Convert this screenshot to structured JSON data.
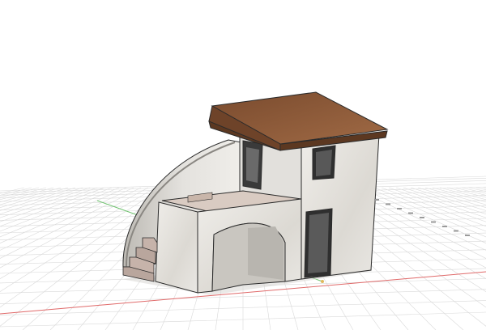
{
  "viewport": {
    "background": "#ffffff",
    "grid": true,
    "view": "perspective",
    "colors": {
      "grid_line": "#d9d9d9",
      "axis_x": "#e06a6a",
      "axis_y": "#6cc26c",
      "roof": "#8b5a3c",
      "roof_dark": "#6e4329",
      "wall": "#e8e6e2",
      "wall_shade": "#cfccc6",
      "opening": "#3a3a3a",
      "steps": "#b9a69d",
      "edge": "#2b2b2b"
    }
  },
  "model": {
    "parts": [
      "roof",
      "upper-wall",
      "lower-wall",
      "curved-wall",
      "terrace",
      "arch",
      "stairs",
      "door",
      "window"
    ]
  }
}
